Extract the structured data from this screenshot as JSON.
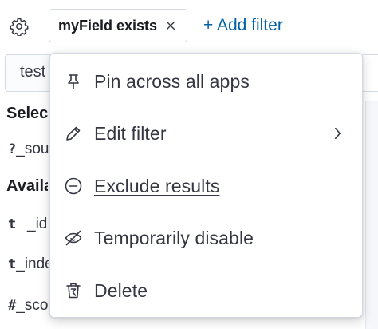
{
  "filter_bar": {
    "filter_pill": {
      "label": "myField exists"
    },
    "add_filter_label": "+ Add filter"
  },
  "sidebar": {
    "search_value": "test",
    "selected_heading": "Selected fields",
    "selected_rows": [
      {
        "type": "?",
        "name": "_source"
      }
    ],
    "available_heading": "Available fields",
    "available_rows": [
      {
        "type": "t",
        "name": "_id"
      },
      {
        "type": "t",
        "name": "_index"
      },
      {
        "type": "#",
        "name": "_score"
      }
    ]
  },
  "menu": {
    "items": [
      {
        "label": "Pin across all apps",
        "icon": "pin-icon"
      },
      {
        "label": "Edit filter",
        "icon": "pencil-icon",
        "has_submenu": true
      },
      {
        "label": "Exclude results",
        "icon": "minus-circle-icon"
      },
      {
        "label": "Temporarily disable",
        "icon": "eye-closed-icon"
      },
      {
        "label": "Delete",
        "icon": "trash-icon"
      }
    ]
  },
  "colors": {
    "link": "#0061a6",
    "text": "#343741",
    "heading": "#1a1c21",
    "border": "#d3dae6"
  }
}
